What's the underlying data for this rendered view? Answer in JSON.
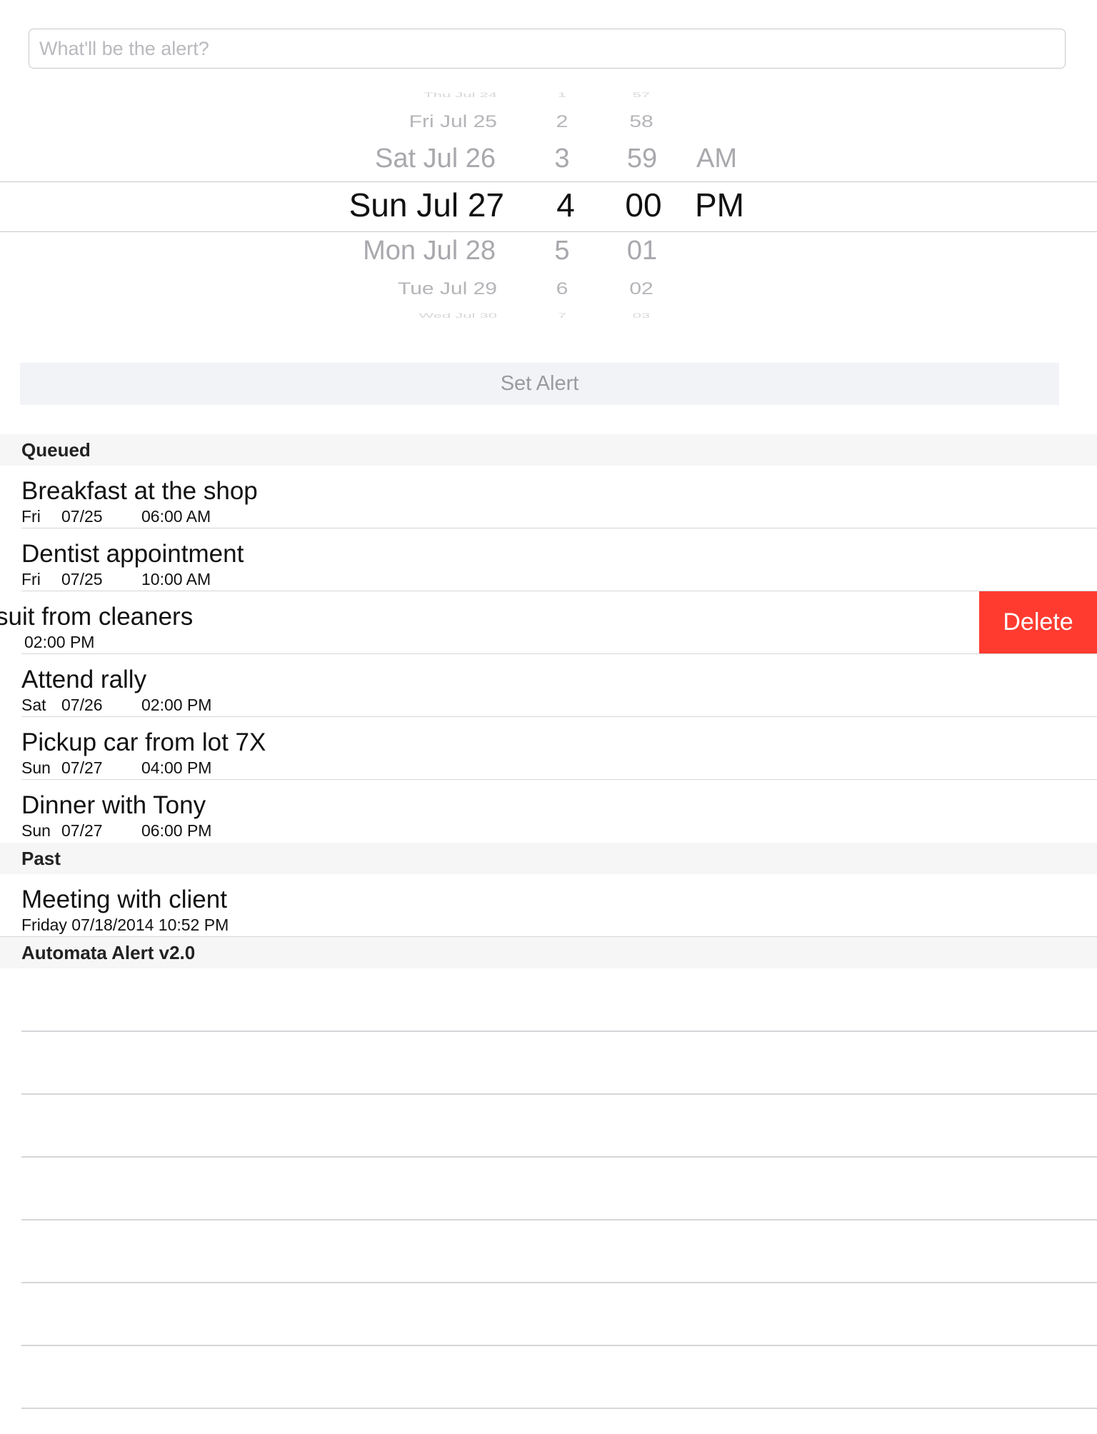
{
  "input": {
    "placeholder": "What'll be the alert?",
    "value": ""
  },
  "picker": {
    "dates": [
      "Thu Jul 24",
      "Fri Jul 25",
      "Sat Jul 26",
      "Sun Jul 27",
      "Mon Jul 28",
      "Tue Jul 29",
      "Wed Jul 30"
    ],
    "hours": [
      "1",
      "2",
      "3",
      "4",
      "5",
      "6",
      "7"
    ],
    "minutes": [
      "57",
      "58",
      "59",
      "00",
      "01",
      "02",
      "03"
    ],
    "ampm": [
      "AM",
      "PM"
    ],
    "selected": {
      "date": "Sun Jul 27",
      "hour": "4",
      "minute": "00",
      "ampm": "PM"
    }
  },
  "set_alert_label": "Set Alert",
  "sections": {
    "queued": {
      "title": "Queued",
      "items": [
        {
          "title": "Breakfast at the shop",
          "day": "Fri",
          "date": "07/25",
          "time": "06:00 AM"
        },
        {
          "title": "Dentist appointment",
          "day": "Fri",
          "date": "07/25",
          "time": "10:00 AM"
        },
        {
          "title": "suit from cleaners",
          "day": "",
          "date": "",
          "time": "02:00 PM"
        },
        {
          "title": "Attend rally",
          "day": "Sat",
          "date": "07/26",
          "time": "02:00 PM"
        },
        {
          "title": "Pickup car from lot 7X",
          "day": "Sun",
          "date": "07/27",
          "time": "04:00 PM"
        },
        {
          "title": "Dinner with Tony",
          "day": "Sun",
          "date": "07/27",
          "time": "06:00 PM"
        }
      ]
    },
    "past": {
      "title": "Past",
      "items": [
        {
          "title": "Meeting with client",
          "subtitle": "Friday 07/18/2014 10:52 PM"
        }
      ]
    },
    "footer": {
      "title": "Automata Alert v2.0"
    }
  },
  "delete_label": "Delete",
  "colors": {
    "delete": "#ff3b30",
    "placeholder": "#b9b9be",
    "section_bg": "#f6f6f7"
  }
}
